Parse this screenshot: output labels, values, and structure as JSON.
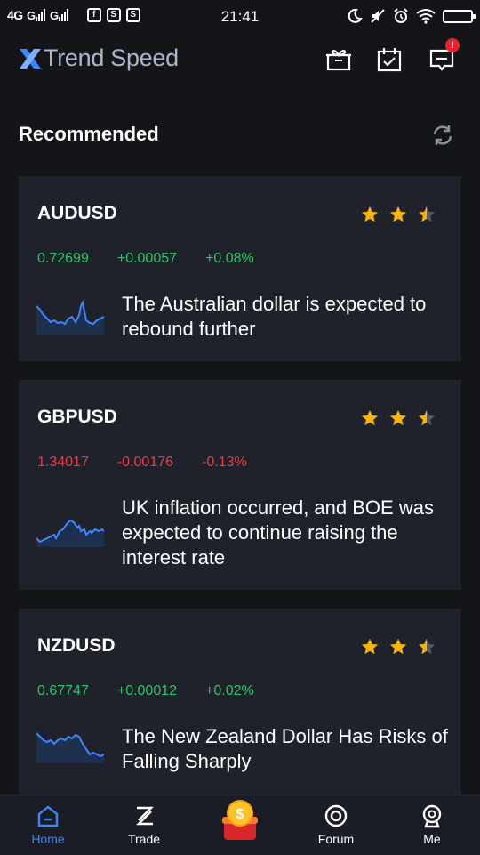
{
  "status_bar": {
    "network": "4G",
    "time": "21:41",
    "app_icons": [
      "f",
      "S",
      "S"
    ]
  },
  "header": {
    "app_name": "Trend Speed",
    "notification_badge": "!"
  },
  "section": {
    "title": "Recommended"
  },
  "cards": [
    {
      "pair": "AUDUSD",
      "price": "0.72699",
      "change": "+0.00057",
      "percent": "+0.08%",
      "direction": "up",
      "rating": 2.5,
      "headline": "The Australian dollar is expected to rebound further"
    },
    {
      "pair": "GBPUSD",
      "price": "1.34017",
      "change": "-0.00176",
      "percent": "-0.13%",
      "direction": "down",
      "rating": 2.5,
      "headline": "UK inflation occurred, and BOE was expected to continue raising the interest rate"
    },
    {
      "pair": "NZDUSD",
      "price": "0.67747",
      "change": "+0.00012",
      "percent": "+0.02%",
      "direction": "up",
      "rating": 2.5,
      "headline": "The New Zealand Dollar Has Risks of Falling Sharply"
    }
  ],
  "tabs": [
    {
      "label": "Home",
      "icon": "home-icon",
      "active": true
    },
    {
      "label": "Trade",
      "icon": "trade-icon",
      "active": false
    },
    {
      "label": "",
      "icon": "coin-bag-icon",
      "active": false
    },
    {
      "label": "Forum",
      "icon": "forum-icon",
      "active": false
    },
    {
      "label": "Me",
      "icon": "profile-icon",
      "active": false
    }
  ],
  "colors": {
    "background": "#141519",
    "card": "#1f212b",
    "up": "#2fc46a",
    "down": "#e24046",
    "accent": "#3d86ff",
    "star": "#f5b400"
  }
}
